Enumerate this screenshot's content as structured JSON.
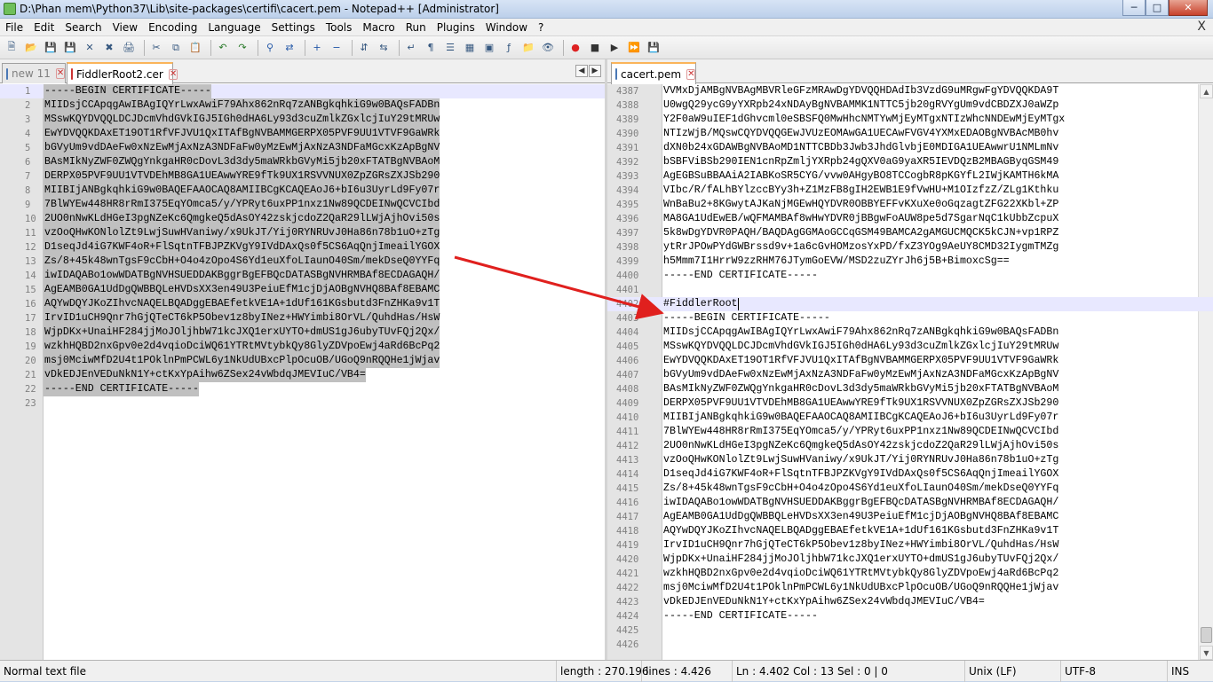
{
  "window": {
    "title": "D:\\Phan mem\\Python37\\Lib\\site-packages\\certifi\\cacert.pem - Notepad++ [Administrator]",
    "buttons": [
      "minimize-icon",
      "maximize-icon",
      "close-icon"
    ]
  },
  "menu": [
    "File",
    "Edit",
    "Search",
    "View",
    "Encoding",
    "Language",
    "Settings",
    "Tools",
    "Macro",
    "Run",
    "Plugins",
    "Window",
    "?"
  ],
  "menu_close_glyph": "X",
  "toolbar_icons": [
    "new-file-icon",
    "open-file-icon",
    "save-icon",
    "save-all-icon",
    "close-icon",
    "close-all-icon",
    "print-icon",
    "cut-icon",
    "copy-icon",
    "paste-icon",
    "undo-icon",
    "redo-icon",
    "find-icon",
    "replace-icon",
    "zoom-in-icon",
    "zoom-out-icon",
    "sync-vertical-icon",
    "sync-horizontal-icon",
    "word-wrap-icon",
    "show-all-chars-icon",
    "indent-guide-icon",
    "udl-icon",
    "doc-map-icon",
    "function-list-icon",
    "folder-workspace-icon",
    "monitoring-icon",
    "record-macro-icon",
    "stop-record-icon",
    "play-macro-icon",
    "play-multiple-icon",
    "save-macro-icon"
  ],
  "left_pane": {
    "tabs": [
      {
        "label": "new 11",
        "active": false
      },
      {
        "label": "FiddlerRoot2.cer",
        "active": true
      }
    ],
    "lines": [
      {
        "n": "1",
        "t": "-----BEGIN CERTIFICATE-----"
      },
      {
        "n": "2",
        "t": "MIIDsjCCApqgAwIBAgIQYrLwxAwiF79Ahx862nRq7zANBgkqhkiG9w0BAQsFADBn"
      },
      {
        "n": "3",
        "t": "MSswKQYDVQQLDCJDcmVhdGVkIGJ5IGh0dHA6Ly93d3cuZmlkZGxlcjIuY29tMRUw"
      },
      {
        "n": "4",
        "t": "EwYDVQQKDAxET19OT1RfVFJVU1QxITAfBgNVBAMMGERPX05PVF9UU1VTVF9GaWRk"
      },
      {
        "n": "5",
        "t": "bGVyUm9vdDAeFw0xNzEwMjAxNzA3NDFaFw0yMzEwMjAxNzA3NDFaMGcxKzApBgNV"
      },
      {
        "n": "6",
        "t": "BAsMIkNyZWF0ZWQgYnkgaHR0cDovL3d3dy5maWRkbGVyMi5jb20xFTATBgNVBAoM"
      },
      {
        "n": "7",
        "t": "DERPX05PVF9UU1VTVDEhMB8GA1UEAwwYRE9fTk9UX1RSVVNUX0ZpZGRsZXJSb290"
      },
      {
        "n": "8",
        "t": "MIIBIjANBgkqhkiG9w0BAQEFAAOCAQ8AMIIBCgKCAQEAoJ6+bI6u3UyrLd9Fy07r"
      },
      {
        "n": "9",
        "t": "7BlWYEw448HR8rRmI375EqYOmca5/y/YPRyt6uxPP1nxz1Nw89QCDEINwQCVCIbd"
      },
      {
        "n": "10",
        "t": "2UO0nNwKLdHGeI3pgNZeKc6QmgkeQ5dAsOY42zskjcdoZ2QaR29lLWjAjhOvi50s"
      },
      {
        "n": "11",
        "t": "vzOoQHwKONlolZt9LwjSuwHVaniwy/x9UkJT/Yij0RYNRUvJ0Ha86n78b1uO+zTg"
      },
      {
        "n": "12",
        "t": "D1seqJd4iG7KWF4oR+FlSqtnTFBJPZKVgY9IVdDAxQs0f5CS6AqQnjImeailYGOX"
      },
      {
        "n": "13",
        "t": "Zs/8+45k48wnTgsF9cCbH+O4o4zOpo4S6Yd1euXfoLIaunO40Sm/mekDseQ0YYFq"
      },
      {
        "n": "14",
        "t": "iwIDAQABo1owWDATBgNVHSUEDDAKBggrBgEFBQcDATASBgNVHRMBAf8ECDAGAQH/"
      },
      {
        "n": "15",
        "t": "AgEAMB0GA1UdDgQWBBQLeHVDsXX3en49U3PeiuEfM1cjDjAOBgNVHQ8BAf8EBAMC"
      },
      {
        "n": "16",
        "t": "AQYwDQYJKoZIhvcNAQELBQADggEBAEfetkVE1A+1dUf161KGsbutd3FnZHKa9v1T"
      },
      {
        "n": "17",
        "t": "IrvID1uCH9Qnr7hGjQTeCT6kP5Obev1z8byINez+HWYimbi8OrVL/QuhdHas/HsW"
      },
      {
        "n": "18",
        "t": "WjpDKx+UnaiHF284jjMoJOljhbW71kcJXQ1erxUYTO+dmUS1gJ6ubyTUvFQj2Qx/"
      },
      {
        "n": "19",
        "t": "wzkhHQBD2nxGpv0e2d4vqioDciWQ61YTRtMVtybkQy8GlyZDVpoEwj4aRd6BcPq2"
      },
      {
        "n": "20",
        "t": "msj0MciwMfD2U4t1POklnPmPCWL6y1NkUdUBxcPlpOcuOB/UGoQ9nRQQHe1jWjav"
      },
      {
        "n": "21",
        "t": "vDkEDJEnVEDuNkN1Y+ctKxYpAihw6ZSex24vWbdqJMEVIuC/VB4="
      },
      {
        "n": "22",
        "t": "-----END CERTIFICATE-----"
      },
      {
        "n": "23",
        "t": ""
      }
    ]
  },
  "right_pane": {
    "tabs": [
      {
        "label": "cacert.pem",
        "active": true
      }
    ],
    "lines": [
      {
        "n": "4387",
        "t": "VVMxDjAMBgNVBAgMBVRleGFzMRAwDgYDVQQHDAdIb3VzdG9uMRgwFgYDVQQKDA9T"
      },
      {
        "n": "4388",
        "t": "U0wgQ29ycG9yYXRpb24xNDAyBgNVBAMMK1NTTC5jb20gRVYgUm9vdCBDZXJ0aWZp"
      },
      {
        "n": "4389",
        "t": "Y2F0aW9uIEF1dGhvcml0eSBSFQ0MwHhcNMTYwMjEyMTgxNTIzWhcNNDEwMjEyMTgx"
      },
      {
        "n": "4390",
        "t": "NTIzWjB/MQswCQYDVQQGEwJVUzEOMAwGA1UECAwFVGV4YXMxEDAOBgNVBAcMB0hv"
      },
      {
        "n": "4391",
        "t": "dXN0b24xGDAWBgNVBAoMD1NTTCBDb3Jwb3JhdGlvbjE0MDIGA1UEAwwrU1NMLmNv"
      },
      {
        "n": "4392",
        "t": "bSBFViBSb290IEN1cnRpZmljYXRpb24gQXV0aG9yaXR5IEVDQzB2MBAGByqGSM49"
      },
      {
        "n": "4393",
        "t": "AgEGBSuBBAAiA2IABKoSR5CYG/vvw0AHgyBO8TCCogbR8pKGYfL2IWjKAMTH6kMA"
      },
      {
        "n": "4394",
        "t": "VIbc/R/fALhBYlzccBYy3h+Z1MzFB8gIH2EWB1E9fVwHU+M1OIzfzZ/ZLg1Kthku"
      },
      {
        "n": "4395",
        "t": "WnBaBu2+8KGwytAJKaNjMGEwHQYDVR0OBBYEFFvKXuXe0oGqzagtZFG22XKbl+ZP"
      },
      {
        "n": "4396",
        "t": "MA8GA1UdEwEB/wQFMAMBAf8wHwYDVR0jBBgwFoAUW8pe5d7SgarNqC1kUbbZcpuX"
      },
      {
        "n": "4397",
        "t": "5k8wDgYDVR0PAQH/BAQDAgGGMAoGCCqGSM49BAMCA2gAMGUCMQCK5kCJN+vp1RPZ"
      },
      {
        "n": "4398",
        "t": "ytRrJPOwPYdGWBrssd9v+1a6cGvHOMzosYxPD/fxZ3YOg9AeUY8CMD32IygmTMZg"
      },
      {
        "n": "4399",
        "t": "h5Mmm7I1HrrW9zzRHM76JTymGoEVW/MSD2zuZYrJh6j5B+BimoxcSg=="
      },
      {
        "n": "4400",
        "t": "-----END CERTIFICATE-----"
      },
      {
        "n": "4401",
        "t": ""
      },
      {
        "n": "4402",
        "t": "#FiddlerRoot"
      },
      {
        "n": "4403",
        "t": "-----BEGIN CERTIFICATE-----"
      },
      {
        "n": "4404",
        "t": "MIIDsjCCApqgAwIBAgIQYrLwxAwiF79Ahx862nRq7zANBgkqhkiG9w0BAQsFADBn"
      },
      {
        "n": "4405",
        "t": "MSswKQYDVQQLDCJDcmVhdGVkIGJ5IGh0dHA6Ly93d3cuZmlkZGxlcjIuY29tMRUw"
      },
      {
        "n": "4406",
        "t": "EwYDVQQKDAxET19OT1RfVFJVU1QxITAfBgNVBAMMGERPX05PVF9UU1VTVF9GaWRk"
      },
      {
        "n": "4407",
        "t": "bGVyUm9vdDAeFw0xNzEwMjAxNzA3NDFaFw0yMzEwMjAxNzA3NDFaMGcxKzApBgNV"
      },
      {
        "n": "4408",
        "t": "BAsMIkNyZWF0ZWQgYnkgaHR0cDovL3d3dy5maWRkbGVyMi5jb20xFTATBgNVBAoM"
      },
      {
        "n": "4409",
        "t": "DERPX05PVF9UU1VTVDEhMB8GA1UEAwwYRE9fTk9UX1RSVVNUX0ZpZGRsZXJSb290"
      },
      {
        "n": "4410",
        "t": "MIIBIjANBgkqhkiG9w0BAQEFAAOCAQ8AMIIBCgKCAQEAoJ6+bI6u3UyrLd9Fy07r"
      },
      {
        "n": "4411",
        "t": "7BlWYEw448HR8rRmI375EqYOmca5/y/YPRyt6uxPP1nxz1Nw89QCDEINwQCVCIbd"
      },
      {
        "n": "4412",
        "t": "2UO0nNwKLdHGeI3pgNZeKc6QmgkeQ5dAsOY42zskjcdoZ2QaR29lLWjAjhOvi50s"
      },
      {
        "n": "4413",
        "t": "vzOoQHwKONlolZt9LwjSuwHVaniwy/x9UkJT/Yij0RYNRUvJ0Ha86n78b1uO+zTg"
      },
      {
        "n": "4414",
        "t": "D1seqJd4iG7KWF4oR+FlSqtnTFBJPZKVgY9IVdDAxQs0f5CS6AqQnjImeailYGOX"
      },
      {
        "n": "4415",
        "t": "Zs/8+45k48wnTgsF9cCbH+O4o4zOpo4S6Yd1euXfoLIaunO40Sm/mekDseQ0YYFq"
      },
      {
        "n": "4416",
        "t": "iwIDAQABo1owWDATBgNVHSUEDDAKBggrBgEFBQcDATASBgNVHRMBAf8ECDAGAQH/"
      },
      {
        "n": "4417",
        "t": "AgEAMB0GA1UdDgQWBBQLeHVDsXX3en49U3PeiuEfM1cjDjAOBgNVHQ8BAf8EBAMC"
      },
      {
        "n": "4418",
        "t": "AQYwDQYJKoZIhvcNAQELBQADggEBAEfetkVE1A+1dUf161KGsbutd3FnZHKa9v1T"
      },
      {
        "n": "4419",
        "t": "IrvID1uCH9Qnr7hGjQTeCT6kP5Obev1z8byINez+HWYimbi8OrVL/QuhdHas/HsW"
      },
      {
        "n": "4420",
        "t": "WjpDKx+UnaiHF284jjMoJOljhbW71kcJXQ1erxUYTO+dmUS1gJ6ubyTUvFQj2Qx/"
      },
      {
        "n": "4421",
        "t": "wzkhHQBD2nxGpv0e2d4vqioDciWQ61YTRtMVtybkQy8GlyZDVpoEwj4aRd6BcPq2"
      },
      {
        "n": "4422",
        "t": "msj0MciwMfD2U4t1POklnPmPCWL6y1NkUdUBxcPlpOcuOB/UGoQ9nRQQHe1jWjav"
      },
      {
        "n": "4423",
        "t": "vDkEDJEnVEDuNkN1Y+ctKxYpAihw6ZSex24vWbdqJMEVIuC/VB4="
      },
      {
        "n": "4424",
        "t": "-----END CERTIFICATE-----"
      },
      {
        "n": "4425",
        "t": ""
      },
      {
        "n": "4426",
        "t": ""
      }
    ]
  },
  "status": {
    "type": "Normal text file",
    "length": "length : 270.196",
    "lines": "lines : 4.426",
    "position": "Ln : 4.402    Col : 13    Sel : 0 | 0",
    "eol": "Unix (LF)",
    "encoding": "UTF-8",
    "mode": "INS"
  },
  "colors": {
    "annotation_arrow": "#e0201e",
    "tab_active_accent": "#fab45a",
    "selection": "#c0c0c0",
    "current_line": "#e8e8ff"
  }
}
